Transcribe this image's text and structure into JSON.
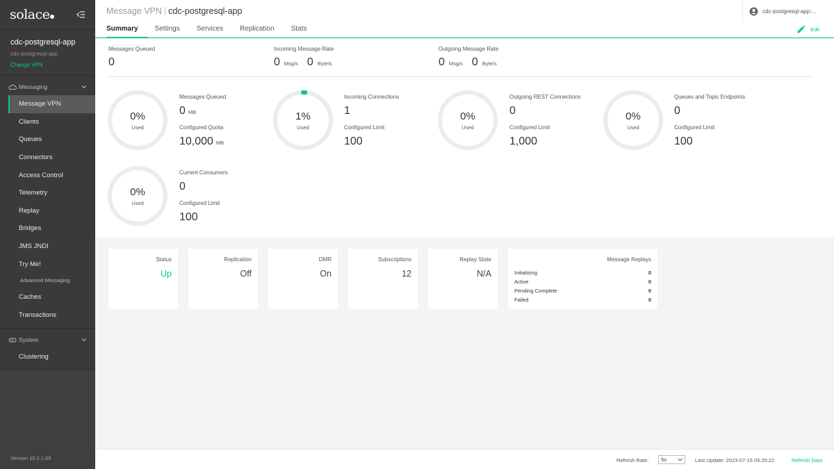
{
  "brand": {
    "logo_text": "solace"
  },
  "sidebar": {
    "vpn_name": "cdc-postgresql-app",
    "vpn_sub": "cdc-postgresql-app",
    "change_vpn": "Change VPN",
    "messaging_section": "Messaging",
    "items": [
      {
        "label": "Message VPN"
      },
      {
        "label": "Clients"
      },
      {
        "label": "Queues"
      },
      {
        "label": "Connectors"
      },
      {
        "label": "Access Control"
      },
      {
        "label": "Telemetry"
      },
      {
        "label": "Replay"
      },
      {
        "label": "Bridges"
      },
      {
        "label": "JMS JNDI"
      },
      {
        "label": "Try Me!"
      }
    ],
    "advanced_label": "Advanced Messaging",
    "advanced_items": [
      {
        "label": "Caches"
      },
      {
        "label": "Transactions"
      }
    ],
    "system_section": "System",
    "system_items": [
      {
        "label": "Clustering"
      }
    ],
    "version": "Version 10.2.1.09"
  },
  "header": {
    "breadcrumb_prefix": "Message VPN",
    "breadcrumb_sep": "|",
    "breadcrumb_current": "cdc-postgresql-app",
    "tabs": [
      {
        "label": "Summary"
      },
      {
        "label": "Settings"
      },
      {
        "label": "Services"
      },
      {
        "label": "Replication"
      },
      {
        "label": "Stats"
      }
    ],
    "active_tab": "Summary",
    "user_label": "cdc-postgresql-app-...",
    "edit_label": "Edit"
  },
  "top_stats": {
    "queued": {
      "label": "Messages Queued",
      "value": "0"
    },
    "incoming": {
      "label": "Incoming Message Rate",
      "msg": "0",
      "msg_unit": "Msg/s",
      "byte": "0",
      "byte_unit": "Byte/s"
    },
    "outgoing": {
      "label": "Outgoing Message Rate",
      "msg": "0",
      "msg_unit": "Msg/s",
      "byte": "0",
      "byte_unit": "Byte/s"
    }
  },
  "gauges": [
    {
      "percent": 0,
      "pct_text": "0%",
      "used": "Used",
      "label1": "Messages Queued",
      "value1": "0",
      "unit1": "MB",
      "label2": "Configured Quota",
      "value2": "10,000",
      "unit2": "MB"
    },
    {
      "percent": 1,
      "pct_text": "1%",
      "used": "Used",
      "label1": "Incoming Connections",
      "value1": "1",
      "unit1": "",
      "label2": "Configured Limit",
      "value2": "100",
      "unit2": ""
    },
    {
      "percent": 0,
      "pct_text": "0%",
      "used": "Used",
      "label1": "Outgoing REST Connections",
      "value1": "0",
      "unit1": "",
      "label2": "Configured Limit",
      "value2": "1,000",
      "unit2": ""
    },
    {
      "percent": 0,
      "pct_text": "0%",
      "used": "Used",
      "label1": "Queues and Topic Endpoints",
      "value1": "0",
      "unit1": "",
      "label2": "Configured Limit",
      "value2": "100",
      "unit2": ""
    },
    {
      "percent": 0,
      "pct_text": "0%",
      "used": "Used",
      "label1": "Current Consumers",
      "value1": "0",
      "unit1": "",
      "label2": "Configured Limit",
      "value2": "100",
      "unit2": ""
    }
  ],
  "cards": [
    {
      "label": "Status",
      "value": "Up"
    },
    {
      "label": "Replication",
      "value": "Off"
    },
    {
      "label": "DMR",
      "value": "On"
    },
    {
      "label": "Subscriptions",
      "value": "12"
    },
    {
      "label": "Replay State",
      "value": "N/A"
    }
  ],
  "replays": {
    "label": "Message Replays",
    "rows": [
      {
        "label": "Initializing",
        "value": "0"
      },
      {
        "label": "Active",
        "value": "0"
      },
      {
        "label": "Pending Complete",
        "value": "0"
      },
      {
        "label": "Failed",
        "value": "0"
      }
    ]
  },
  "footer": {
    "refresh_rate_label": "Refresh Rate:",
    "refresh_rate_value": "5s",
    "last_update": "Last Update: 2023-07-15 05:25:22",
    "refresh_data": "Refresh Data"
  },
  "colors": {
    "accent": "#00c895",
    "sidebar_bg": "#3a3a3a",
    "gauge_track": "#ececec"
  }
}
